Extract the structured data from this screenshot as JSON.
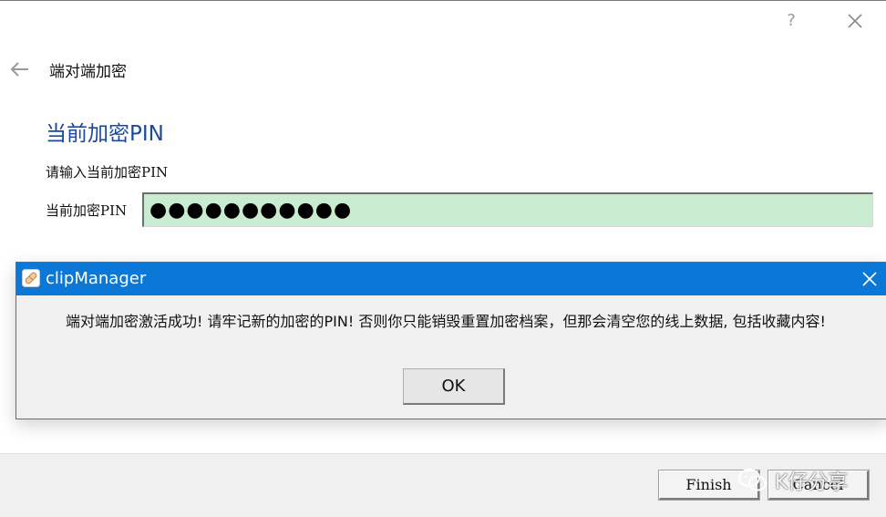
{
  "titlebar": {
    "help_label": "?",
    "close_icon": "close-icon"
  },
  "wizard": {
    "back_icon": "arrow-left-icon",
    "title": "端对端加密",
    "section_title": "当前加密PIN",
    "instruction": "请输入当前加密PIN",
    "pin_label": "当前加密PIN",
    "pin_value": "●●●●●●●●●●●",
    "pin_field_color": "#c9ecd0"
  },
  "footer": {
    "finish_label": "Finish",
    "cancel_label": "Cancel"
  },
  "dialog": {
    "title": "clipManager",
    "app_icon": "clipmanager-app-icon",
    "titlebar_color": "#0b78d7",
    "message": "端对端加密激活成功! 请牢记新的加密的PIN! 否则你只能销毁重置加密档案，但那会清空您的线上数据, 包括收藏内容!",
    "ok_label": "OK"
  },
  "watermark": {
    "text": "K仔分享",
    "icon": "wechat-icon"
  }
}
